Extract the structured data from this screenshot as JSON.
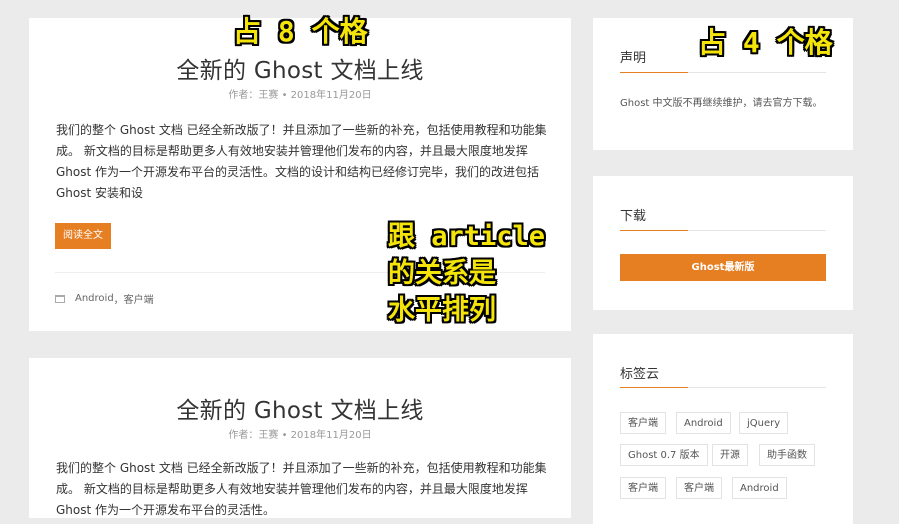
{
  "articles": [
    {
      "title": "全新的 Ghost 文档上线",
      "meta": "作者：王赛 • 2018年11月20日",
      "excerpt": "我们的整个 Ghost 文档 已经全新改版了！并且添加了一些新的补充，包括使用教程和功能集成。 新文档的目标是帮助更多人有效地安装并管理他们发布的内容，并且最大限度地发挥 Ghost 作为一个开源发布平台的灵活性。文档的设计和结构已经修订完毕，我们的改进包括 Ghost 安装和设",
      "read_more": "阅读全文",
      "tag1": "Android",
      "tag_sep": "，",
      "tag2": "客户端"
    },
    {
      "title": "全新的 Ghost 文档上线",
      "meta": "作者：王赛 • 2018年11月20日",
      "excerpt": "我们的整个 Ghost 文档 已经全新改版了！并且添加了一些新的补充，包括使用教程和功能集成。 新文档的目标是帮助更多人有效地安装并管理他们发布的内容，并且最大限度地发挥 Ghost 作为一个开源发布平台的灵活性。"
    }
  ],
  "sidebar": {
    "notice": {
      "title": "声明",
      "text": "Ghost 中文版不再继续维护，请去官方下载。"
    },
    "download": {
      "title": "下载",
      "button": "Ghost最新版"
    },
    "tagcloud": {
      "title": "标签云",
      "tags": [
        "客户端",
        "Android",
        "jQuery",
        "Ghost 0.7 版本",
        "开源",
        "助手函数",
        "客户端",
        "客户端",
        "Android"
      ]
    }
  },
  "annotations": {
    "main_width": "占 8 个格",
    "sidebar_width": "占 4 个格",
    "relation_line1": "跟 article",
    "relation_line2": "的关系是",
    "relation_line3": "水平排列"
  },
  "colors": {
    "accent": "#e67e22",
    "annotation": "#f4e409",
    "background": "#ebebeb"
  }
}
